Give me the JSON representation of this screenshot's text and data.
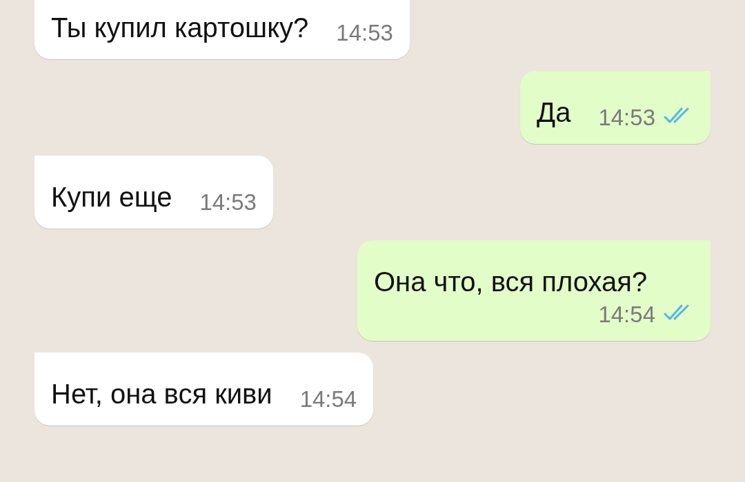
{
  "messages": [
    {
      "kind": "incoming",
      "text": "Ты купил картошку?",
      "time": "14:53"
    },
    {
      "kind": "outgoing",
      "text": "Да",
      "time": "14:53",
      "read": true
    },
    {
      "kind": "incoming",
      "text": "Купи еще",
      "time": "14:53"
    },
    {
      "kind": "outgoing",
      "text": "Она что, вся плохая?",
      "time": "14:54",
      "read": true
    },
    {
      "kind": "incoming",
      "text": "Нет, она вся киви",
      "time": "14:54"
    }
  ]
}
